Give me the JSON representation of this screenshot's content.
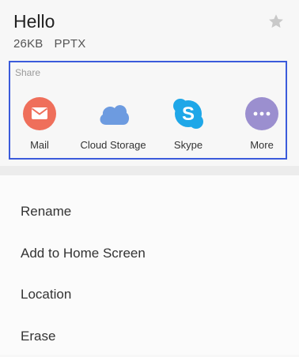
{
  "file": {
    "name": "Hello",
    "size": "26KB",
    "type": "PPTX"
  },
  "favorite": {
    "icon": "star-icon"
  },
  "share": {
    "label": "Share",
    "items": [
      {
        "label": "Mail",
        "icon": "mail-icon",
        "color": "#ef6f5b"
      },
      {
        "label": "Cloud Storage",
        "icon": "cloud-icon",
        "color": "#6d9be0"
      },
      {
        "label": "Skype",
        "icon": "skype-icon",
        "color": "#1fa7e8"
      },
      {
        "label": "More",
        "icon": "more-icon",
        "color": "#9b8fcf"
      }
    ]
  },
  "menu": {
    "items": [
      {
        "label": "Rename"
      },
      {
        "label": "Add to Home Screen"
      },
      {
        "label": "Location"
      },
      {
        "label": "Erase"
      }
    ]
  }
}
